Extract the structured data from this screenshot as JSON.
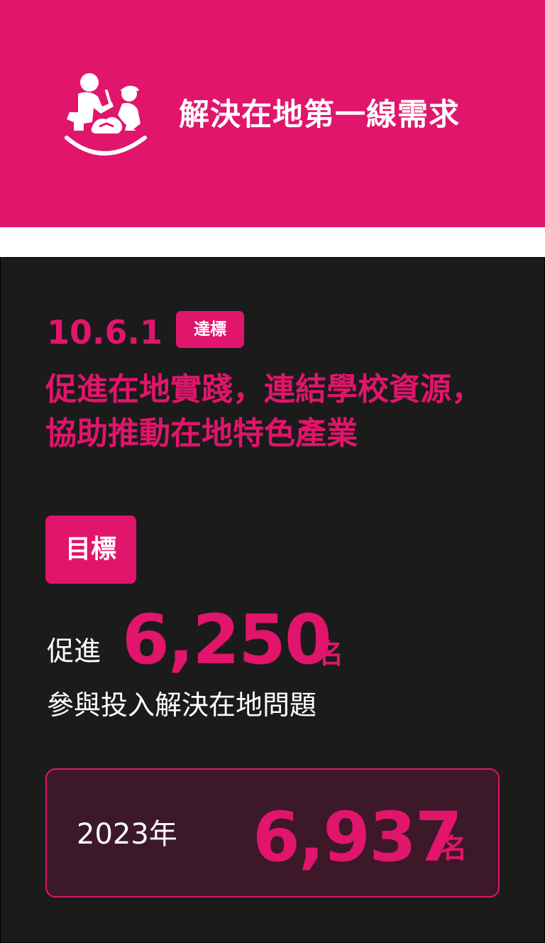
{
  "header": {
    "icon": "community-help-icon",
    "title": "解決在地第一線需求"
  },
  "goal": {
    "code": "10.6.1",
    "status_badge": "達標",
    "title": "促進在地實踐，連結學校資源，協助推動在地特色產業"
  },
  "target": {
    "badge": "目標",
    "prefix": "促進",
    "value": "6,250",
    "unit": "名",
    "description": "參與投入解決在地問題"
  },
  "result": {
    "year_label": "2023年",
    "value": "6,937",
    "unit": "名"
  },
  "colors": {
    "accent": "#e0156b",
    "card_bg": "#1b1b1b",
    "result_bg": "#3c1829",
    "text_light": "#ffffff"
  }
}
